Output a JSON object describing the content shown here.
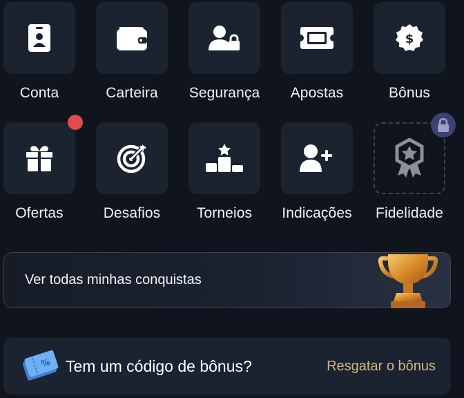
{
  "tiles_row1": [
    {
      "label": "Conta",
      "icon": "id-card-icon"
    },
    {
      "label": "Carteira",
      "icon": "wallet-icon"
    },
    {
      "label": "Segurança",
      "icon": "user-lock-icon"
    },
    {
      "label": "Apostas",
      "icon": "ticket-icon"
    },
    {
      "label": "Bônus",
      "icon": "dollar-badge-icon"
    }
  ],
  "tiles_row2": [
    {
      "label": "Ofertas",
      "icon": "gift-icon",
      "notification_dot": true
    },
    {
      "label": "Desafios",
      "icon": "target-icon"
    },
    {
      "label": "Torneios",
      "icon": "podium-icon"
    },
    {
      "label": "Indicações",
      "icon": "user-plus-icon"
    },
    {
      "label": "Fidelidade",
      "icon": "medal-star-icon",
      "locked": true
    }
  ],
  "achievements": {
    "label": "Ver todas minhas conquistas",
    "icon": "trophy-icon"
  },
  "bonus_code": {
    "question": "Tem um código de bônus?",
    "action": "Resgatar o bônus",
    "icon": "coupon-ticket-icon"
  },
  "colors": {
    "background": "#0f141d",
    "tile": "#1b2230",
    "notification": "#e5484d",
    "lock_badge": "#3b4170",
    "accent_gold": "#d8b77c"
  }
}
